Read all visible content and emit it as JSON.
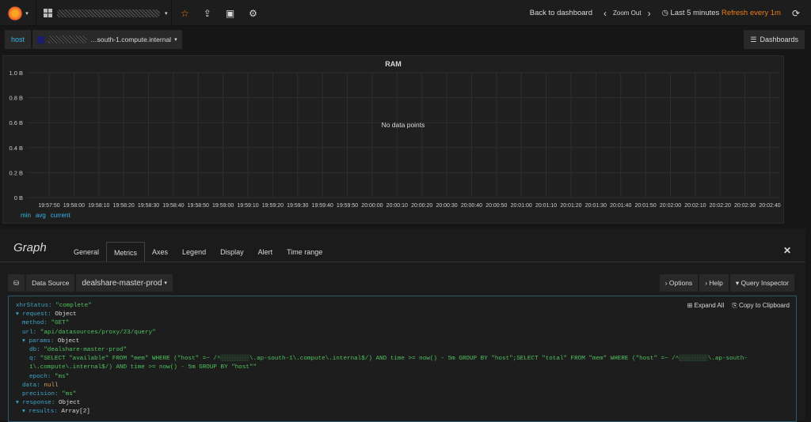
{
  "topbar": {
    "dashboard_title": "(redacted)",
    "back": "Back to dashboard",
    "zoom_out": "Zoom Out",
    "time_range": "Last 5 minutes",
    "refresh": "Refresh every 1m",
    "icons": [
      "star-icon",
      "share-icon",
      "save-icon",
      "gear-icon",
      "refresh-icon"
    ]
  },
  "variables": {
    "label": "host",
    "value": "…south-1.compute.internal"
  },
  "dashboards_btn": "Dashboards",
  "panel": {
    "title": "RAM",
    "no_data": "No data points",
    "legend": [
      "min",
      "avg",
      "current"
    ]
  },
  "chart_data": {
    "type": "line",
    "title": "RAM",
    "series": [],
    "ylim": [
      0,
      1
    ],
    "yticks": [
      "0 B",
      "0.2 B",
      "0.4 B",
      "0.6 B",
      "0.8 B",
      "1.0 B"
    ],
    "xticks": [
      "19:57:50",
      "19:58:00",
      "19:58:10",
      "19:58:20",
      "19:58:30",
      "19:58:40",
      "19:58:50",
      "19:59:00",
      "19:59:10",
      "19:59:20",
      "19:59:30",
      "19:59:40",
      "19:59:50",
      "20:00:00",
      "20:00:10",
      "20:00:20",
      "20:00:30",
      "20:00:40",
      "20:00:50",
      "20:01:00",
      "20:01:10",
      "20:01:20",
      "20:01:30",
      "20:01:40",
      "20:01:50",
      "20:02:00",
      "20:02:10",
      "20:02:20",
      "20:02:30",
      "20:02:40"
    ],
    "annotation": "No data points"
  },
  "editor": {
    "title": "Graph",
    "tabs": [
      "General",
      "Metrics",
      "Axes",
      "Legend",
      "Display",
      "Alert",
      "Time range"
    ],
    "active_tab": "Metrics"
  },
  "query": {
    "data_source_label": "Data Source",
    "data_source": "dealshare-master-prod",
    "options": "Options",
    "help": "Help",
    "inspector": "Query Inspector"
  },
  "inspector": {
    "expand_all": "Expand All",
    "copy": "Copy to Clipboard",
    "lines": [
      {
        "k": "xhrStatus: ",
        "v": "\"complete\"",
        "c": "s",
        "lvl": 1
      },
      {
        "k": "▾ request: ",
        "v": "Object",
        "c": "o",
        "lvl": 1
      },
      {
        "k": "method: ",
        "v": "\"GET\"",
        "c": "s",
        "lvl": 2
      },
      {
        "k": "url: ",
        "v": "\"api/datasources/proxy/23/query\"",
        "c": "s",
        "lvl": 2
      },
      {
        "k": "▾ params: ",
        "v": "Object",
        "c": "o",
        "lvl": 2
      },
      {
        "k": "db: ",
        "v": "\"dealshare-master-prod\"",
        "c": "s",
        "lvl": 3
      },
      {
        "k": "q: ",
        "v": "\"SELECT \"available\" FROM \"mem\" WHERE (\"host\" =~ /^░░░░░░░░\\.ap-south-1\\.compute\\.internal$/) AND time >= now() - 5m GROUP BY \"host\";SELECT \"total\" FROM \"mem\" WHERE (\"host\" =~ /^░░░░░░░░\\.ap-south-1\\.compute\\.internal$/) AND time >= now() - 5m GROUP BY \"host\"\"",
        "c": "s",
        "lvl": 3
      },
      {
        "k": "epoch: ",
        "v": "\"ms\"",
        "c": "s",
        "lvl": 3
      },
      {
        "k": "data: ",
        "v": "null",
        "c": "n",
        "lvl": 2
      },
      {
        "k": "precision: ",
        "v": "\"ms\"",
        "c": "s",
        "lvl": 2
      },
      {
        "k": "▾ response: ",
        "v": "Object",
        "c": "o",
        "lvl": 1
      },
      {
        "k": "▾ results: ",
        "v": "Array[2]",
        "c": "o",
        "lvl": 2
      }
    ]
  }
}
